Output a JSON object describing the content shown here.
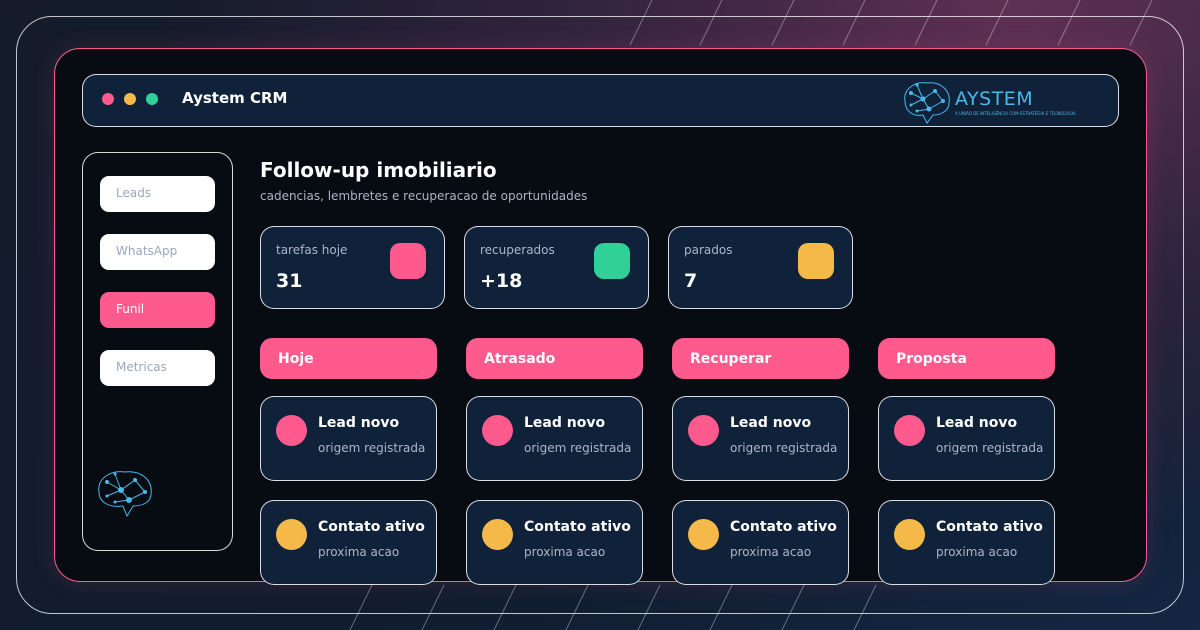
{
  "titlebar": {
    "app_title": "Aystem CRM",
    "brand_name": "AYSTEM",
    "brand_tagline": "A UNIÃO DE INTELIGÊNCIA COM ESTRATÉGIA E TECNOLOGIA"
  },
  "sidebar": {
    "items": [
      {
        "label": "Leads",
        "active": false
      },
      {
        "label": "WhatsApp",
        "active": false
      },
      {
        "label": "Funil",
        "active": true
      },
      {
        "label": "Metricas",
        "active": false
      }
    ]
  },
  "main": {
    "title": "Follow-up imobiliario",
    "subtitle": "cadencias, lembretes e recuperacao de oportunidades",
    "stats": [
      {
        "label": "tarefas hoje",
        "value": "31",
        "color": "#ff5a8e"
      },
      {
        "label": "recuperados",
        "value": "+18",
        "color": "#2fd199"
      },
      {
        "label": "parados",
        "value": "7",
        "color": "#f5b94a"
      }
    ],
    "columns": [
      {
        "title": "Hoje",
        "cards": [
          {
            "title": "Lead novo",
            "subtitle": "origem registrada",
            "color": "#ff5a8e"
          },
          {
            "title": "Contato ativo",
            "subtitle": "proxima acao",
            "color": "#f5b94a"
          }
        ]
      },
      {
        "title": "Atrasado",
        "cards": [
          {
            "title": "Lead novo",
            "subtitle": "origem registrada",
            "color": "#ff5a8e"
          },
          {
            "title": "Contato ativo",
            "subtitle": "proxima acao",
            "color": "#f5b94a"
          }
        ]
      },
      {
        "title": "Recuperar",
        "cards": [
          {
            "title": "Lead novo",
            "subtitle": "origem registrada",
            "color": "#ff5a8e"
          },
          {
            "title": "Contato ativo",
            "subtitle": "proxima acao",
            "color": "#f5b94a"
          }
        ]
      },
      {
        "title": "Proposta",
        "cards": [
          {
            "title": "Lead novo",
            "subtitle": "origem registrada",
            "color": "#ff5a8e"
          },
          {
            "title": "Contato ativo",
            "subtitle": "proxima acao",
            "color": "#f5b94a"
          }
        ]
      }
    ]
  },
  "colors": {
    "accent_pink": "#ff5a8e",
    "accent_green": "#2fd199",
    "accent_yellow": "#f5b94a",
    "brand_blue": "#49b8ea",
    "panel": "#10223a"
  }
}
